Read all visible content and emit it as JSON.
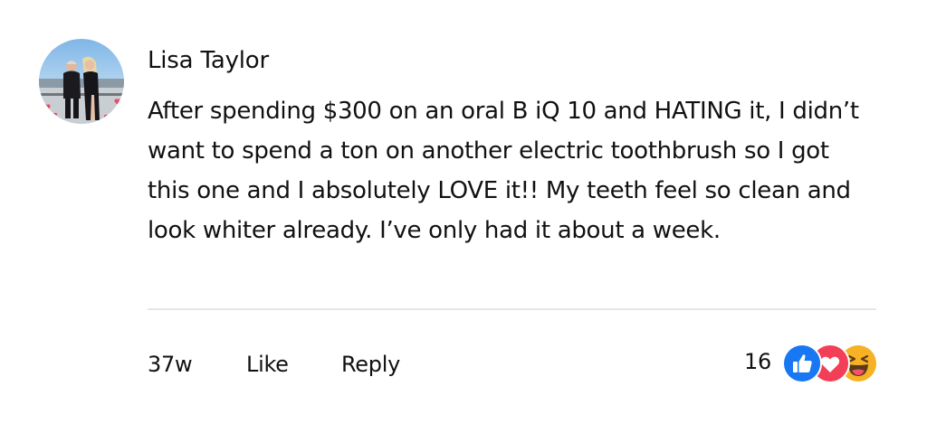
{
  "comment": {
    "author": "Lisa Taylor",
    "text": "After spending $300 on an oral B iQ 10 and HATING it, I didn’t want to spend a ton on another electric toothbrush so I got this one and I absolutely LOVE it!! My teeth feel so clean and look whiter already. I’ve only had it about a week.",
    "timestamp": "37w",
    "like_label": "Like",
    "reply_label": "Reply",
    "reaction_count": "16",
    "reactions": [
      "like-icon",
      "love-icon",
      "haha-icon"
    ]
  },
  "colors": {
    "like_blue": "#1877f2",
    "love_red": "#f33e58",
    "haha_yellow": "#f7b125",
    "divider": "#e6e6e6"
  }
}
